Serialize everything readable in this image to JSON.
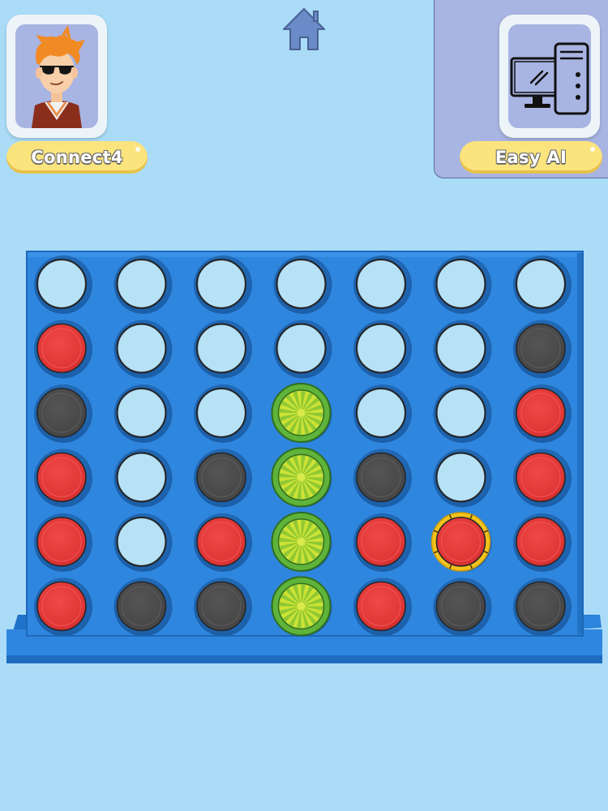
{
  "players": {
    "human": {
      "name": "Connect4",
      "avatar": "boy-with-sunglasses-avatar"
    },
    "ai": {
      "name": "Easy AI",
      "avatar": "desktop-computer-icon",
      "active_turn": true
    }
  },
  "header": {
    "home_icon": "home-icon"
  },
  "board": {
    "columns": 7,
    "rows": 6,
    "grid": [
      [
        "empty",
        "empty",
        "empty",
        "empty",
        "empty",
        "empty",
        "empty"
      ],
      [
        "red",
        "empty",
        "empty",
        "empty",
        "empty",
        "empty",
        "black"
      ],
      [
        "black",
        "empty",
        "empty",
        "win",
        "empty",
        "empty",
        "red"
      ],
      [
        "red",
        "empty",
        "black",
        "win",
        "black",
        "empty",
        "red"
      ],
      [
        "red",
        "empty",
        "red",
        "win",
        "red",
        "last",
        "red"
      ],
      [
        "red",
        "black",
        "black",
        "win",
        "red",
        "black",
        "black"
      ]
    ]
  },
  "colors": {
    "background": "#aadcf7",
    "board": "#2f86de",
    "board_dark": "#1e6bc0",
    "empty_hole": "#b7e1f5",
    "red": "#e23a3a",
    "black": "#4b4b4b",
    "win_green": "#5fb33a",
    "win_yellow": "#cce236",
    "last_move_ring": "#f4c21c",
    "pill": "#fbe47d",
    "ai_panel": "#a8b4e2"
  }
}
